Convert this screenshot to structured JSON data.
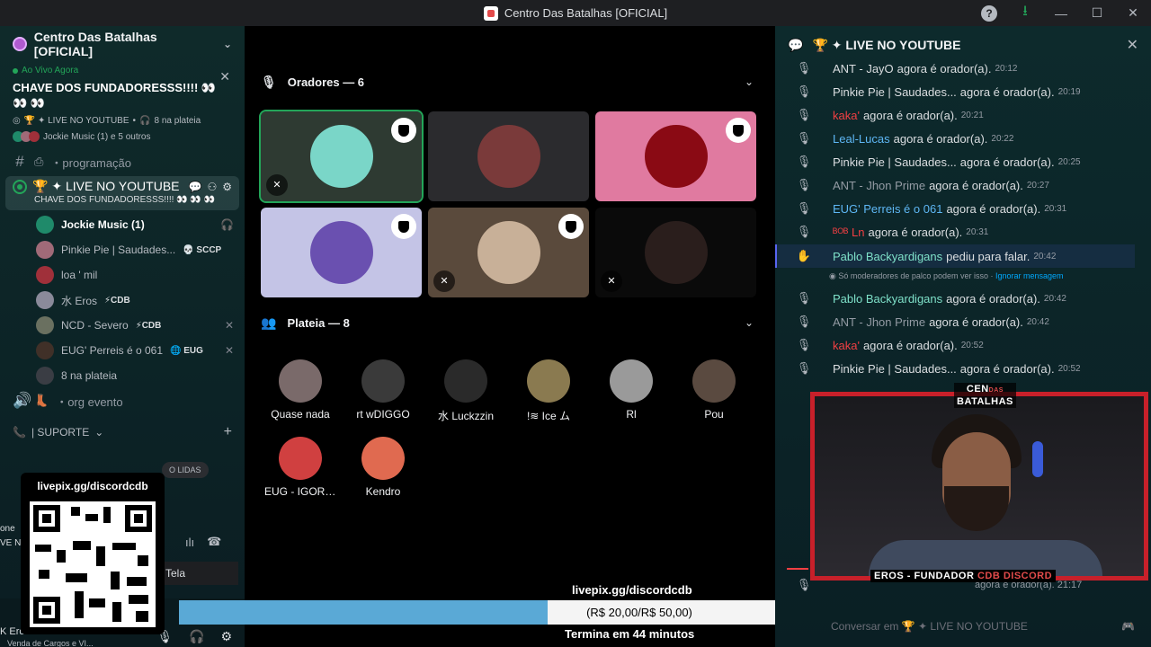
{
  "titlebar": {
    "title": "Centro Das Batalhas [OFICIAL]"
  },
  "guild": {
    "name": "Centro Das Batalhas [OFICIAL]"
  },
  "live": {
    "status": "Ao Vivo Agora",
    "title": "CHAVE DOS FUNDADORESSS!!!! 👀 👀 👀",
    "stage": "🏆 ✦ LIVE NO YOUTUBE",
    "audience": "8 na plateia",
    "speakers": "Jockie Music (1) e 5 outros"
  },
  "channels": {
    "programacao": "・programação",
    "stage_name": "🏆 ✦ LIVE NO YOUTUBE",
    "stage_topic": "CHAVE DOS FUNDADORESSS!!!! 👀 👀 👀",
    "org_evento": "・org evento",
    "suporte": "| SUPORTE",
    "lidas": "O LIDAS"
  },
  "voice_members": [
    {
      "name": "Jockie Music (1)",
      "tag": "",
      "color": "#1f8a6a",
      "bold": true,
      "right": "🎧"
    },
    {
      "name": "Pinkie Pie | Saudades...",
      "tag": "💀 SCCP",
      "color": "#a06a78",
      "bold": false,
      "right": ""
    },
    {
      "name": "loa ' mil",
      "tag": "",
      "color": "#a0303a",
      "bold": false,
      "right": ""
    },
    {
      "name": "水 Eros",
      "tag": "⚡CDB",
      "color": "#8a8a9a",
      "bold": false,
      "right": ""
    },
    {
      "name": "NCD - Severo",
      "tag": "⚡CDB",
      "color": "#6a7060",
      "bold": false,
      "right": "✕"
    },
    {
      "name": "EUG' Perreis é o 061",
      "tag": "🌐 EUG",
      "color": "#403028",
      "bold": false,
      "right": "✕"
    },
    {
      "name": "8 na plateia",
      "tag": "",
      "color": "#3a3d44",
      "bold": false,
      "right": ""
    }
  ],
  "left_edge": {
    "a": "one",
    "b": "VE N",
    "c": "K Erc",
    "d": "Venda de Cargos e VI..."
  },
  "voice_panel": {
    "tela": "Tela"
  },
  "qr": {
    "url": "livepix.gg/discordcdb"
  },
  "stage": {
    "speakers_header": "Oradores — 6",
    "audience_header": "Plateia — 8",
    "speaker_tiles": [
      {
        "bg": "#2e3a32",
        "avatar": "#7ad6c8",
        "mod": true,
        "muted": true,
        "speaking": true
      },
      {
        "bg": "#2b2b2e",
        "avatar": "#7a3a3a",
        "mod": false,
        "muted": false,
        "speaking": false
      },
      {
        "bg": "#e07aa0",
        "avatar": "#8a0a14",
        "mod": true,
        "muted": false,
        "speaking": false
      },
      {
        "bg": "#c4c4e6",
        "avatar": "#6a50b0",
        "mod": true,
        "muted": false,
        "speaking": false
      },
      {
        "bg": "#5a4a3c",
        "avatar": "#c8b098",
        "mod": true,
        "muted": true,
        "speaking": false
      },
      {
        "bg": "#0a0a0a",
        "avatar": "#2a1e1c",
        "mod": false,
        "muted": true,
        "speaking": false
      }
    ],
    "audience": [
      {
        "name": "Quase nada",
        "color": "#7a6a6a"
      },
      {
        "name": "rt wDIGGO",
        "color": "#3a3a3a"
      },
      {
        "name": "水 Luckzzin",
        "color": "#2a2a2a"
      },
      {
        "name": "!≋ Ice ム",
        "color": "#8a7a50"
      },
      {
        "name": "Rl",
        "color": "#9a9a9a"
      },
      {
        "name": "Pou",
        "color": "#5a4a40"
      },
      {
        "name": "EUG - IGORZ ...",
        "color": "#d04040"
      },
      {
        "name": "Kendro",
        "color": "#e06a50"
      }
    ]
  },
  "donation": {
    "url": "livepix.gg/discordcdb",
    "amount": "(R$ 20,00/R$ 50,00)",
    "progress": 0.4,
    "time_left": "Termina em 44 minutos"
  },
  "chat": {
    "title": "🏆 ✦ LIVE NO YOUTUBE",
    "messages": [
      {
        "who": "ANT - JayO",
        "color": "#dbdee1",
        "text": "agora é orador(a).",
        "time": "20:12",
        "icon": "🎙"
      },
      {
        "who": "Pinkie Pie | Saudades...",
        "color": "#dbdee1",
        "text": "agora é orador(a).",
        "time": "20:19",
        "icon": "🎙"
      },
      {
        "who": "kaka'",
        "color": "#f23f43",
        "text": "agora é orador(a).",
        "time": "20:21",
        "icon": "🎙"
      },
      {
        "who": "Leal-Lucas",
        "color": "#5eb7f5",
        "text": "agora é orador(a).",
        "time": "20:22",
        "icon": "🎙"
      },
      {
        "who": "Pinkie Pie | Saudades...",
        "color": "#dbdee1",
        "text": "agora é orador(a).",
        "time": "20:25",
        "icon": "🎙"
      },
      {
        "who": "ANT - Jhon Prime",
        "color": "#949ba4",
        "text": "agora é orador(a).",
        "time": "20:27",
        "icon": "🎙"
      },
      {
        "who": "EUG' Perreis é o 061",
        "color": "#5eb7f5",
        "text": "agora é orador(a).",
        "time": "20:31",
        "icon": "🎙"
      },
      {
        "who": "ᴮᴼᴮ Ln",
        "color": "#f23f43",
        "text": "agora é orador(a).",
        "time": "20:31",
        "icon": "🎙"
      },
      {
        "who": "Pablo Backyardigans",
        "color": "#7fe1c9",
        "text": "pediu para falar.",
        "time": "20:42",
        "icon": "✋"
      },
      {
        "who": "Pablo Backyardigans",
        "color": "#7fe1c9",
        "text": "agora é orador(a).",
        "time": "20:42",
        "icon": "🎙"
      },
      {
        "who": "ANT - Jhon Prime",
        "color": "#949ba4",
        "text": "agora é orador(a).",
        "time": "20:42",
        "icon": "🎙"
      },
      {
        "who": "kaka'",
        "color": "#f23f43",
        "text": "agora é orador(a).",
        "time": "20:52",
        "icon": "🎙"
      },
      {
        "who": "Pinkie Pie | Saudades...",
        "color": "#dbdee1",
        "text": "agora é orador(a).",
        "time": "20:52",
        "icon": "🎙"
      }
    ],
    "note": "Só moderadores de palco podem ver isso · ",
    "note_link": "Ignorar mensagem",
    "tail_text": "agora é orador(a). 21:17",
    "input_placeholder": "Conversar em 🏆 ✦ LIVE NO YOUTUBE"
  },
  "cam": {
    "logo_top": "CEN",
    "logo_small": "DAS",
    "logo_bottom": "BATALHAS",
    "label_white": "EROS - FUNDADOR",
    "label_red": "CDB DISCORD"
  }
}
